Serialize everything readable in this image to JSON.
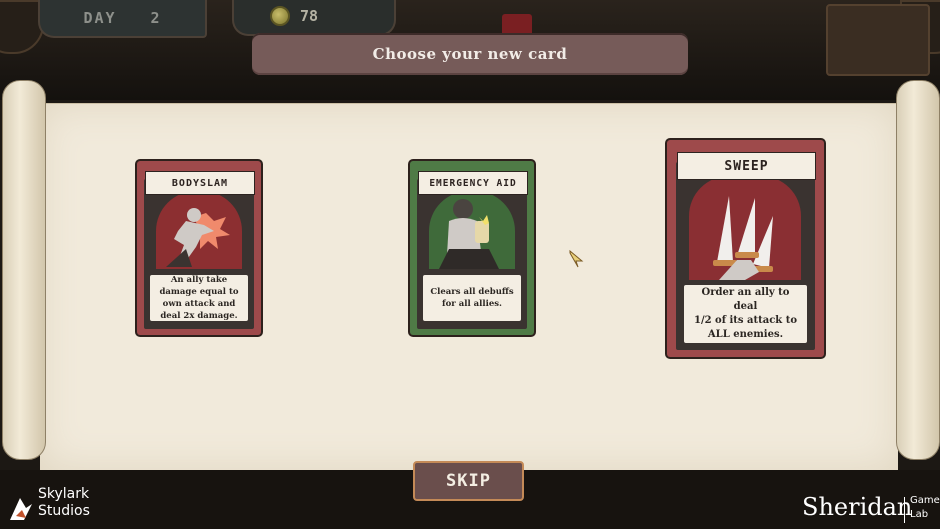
{
  "hud": {
    "day_label": "DAY",
    "day_value": "2",
    "gold_value": "78",
    "coin_icon": "coin-icon"
  },
  "title": "Choose your new card",
  "cards": [
    {
      "name": "BODYSLAM",
      "description": "An ally take damage equal to own attack and deal 2x damage.",
      "frame_color": "#9e4a4b",
      "art": "bodyslam-art"
    },
    {
      "name": "EMERGENCY AID",
      "description": "Clears all debuffs for all allies.",
      "frame_color": "#4f7b46",
      "art": "emergency-aid-art"
    },
    {
      "name": "SWEEP",
      "description_lines": [
        "Order an ally to deal",
        "1/2 of its attack to",
        "ALL enemies."
      ],
      "frame_color": "#9e4a4b",
      "art": "sweep-art",
      "highlighted": true
    }
  ],
  "skip_label": "SKIP",
  "watermark_left": [
    "Skylark",
    "Studios"
  ],
  "watermark_right": {
    "name": "Sheridan",
    "sub": [
      "Game",
      "Lab"
    ]
  }
}
